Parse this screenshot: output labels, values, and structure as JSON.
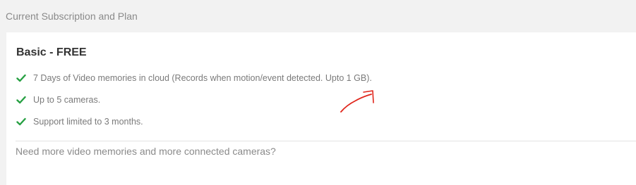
{
  "section": {
    "title": "Current Subscription and Plan"
  },
  "plan": {
    "name": "Basic - FREE",
    "features": [
      "7 Days of Video memories in cloud (Records when motion/event detected. Upto 1 GB).",
      "Up to 5 cameras.",
      "Support limited to 3 months."
    ],
    "upsell_text": "Need more video memories and more connected cameras?"
  },
  "colors": {
    "check": "#27a043",
    "annotation": "#e0251b"
  },
  "icons": {
    "feature_icon": "check-icon",
    "annotation": "arrow-annotation"
  }
}
